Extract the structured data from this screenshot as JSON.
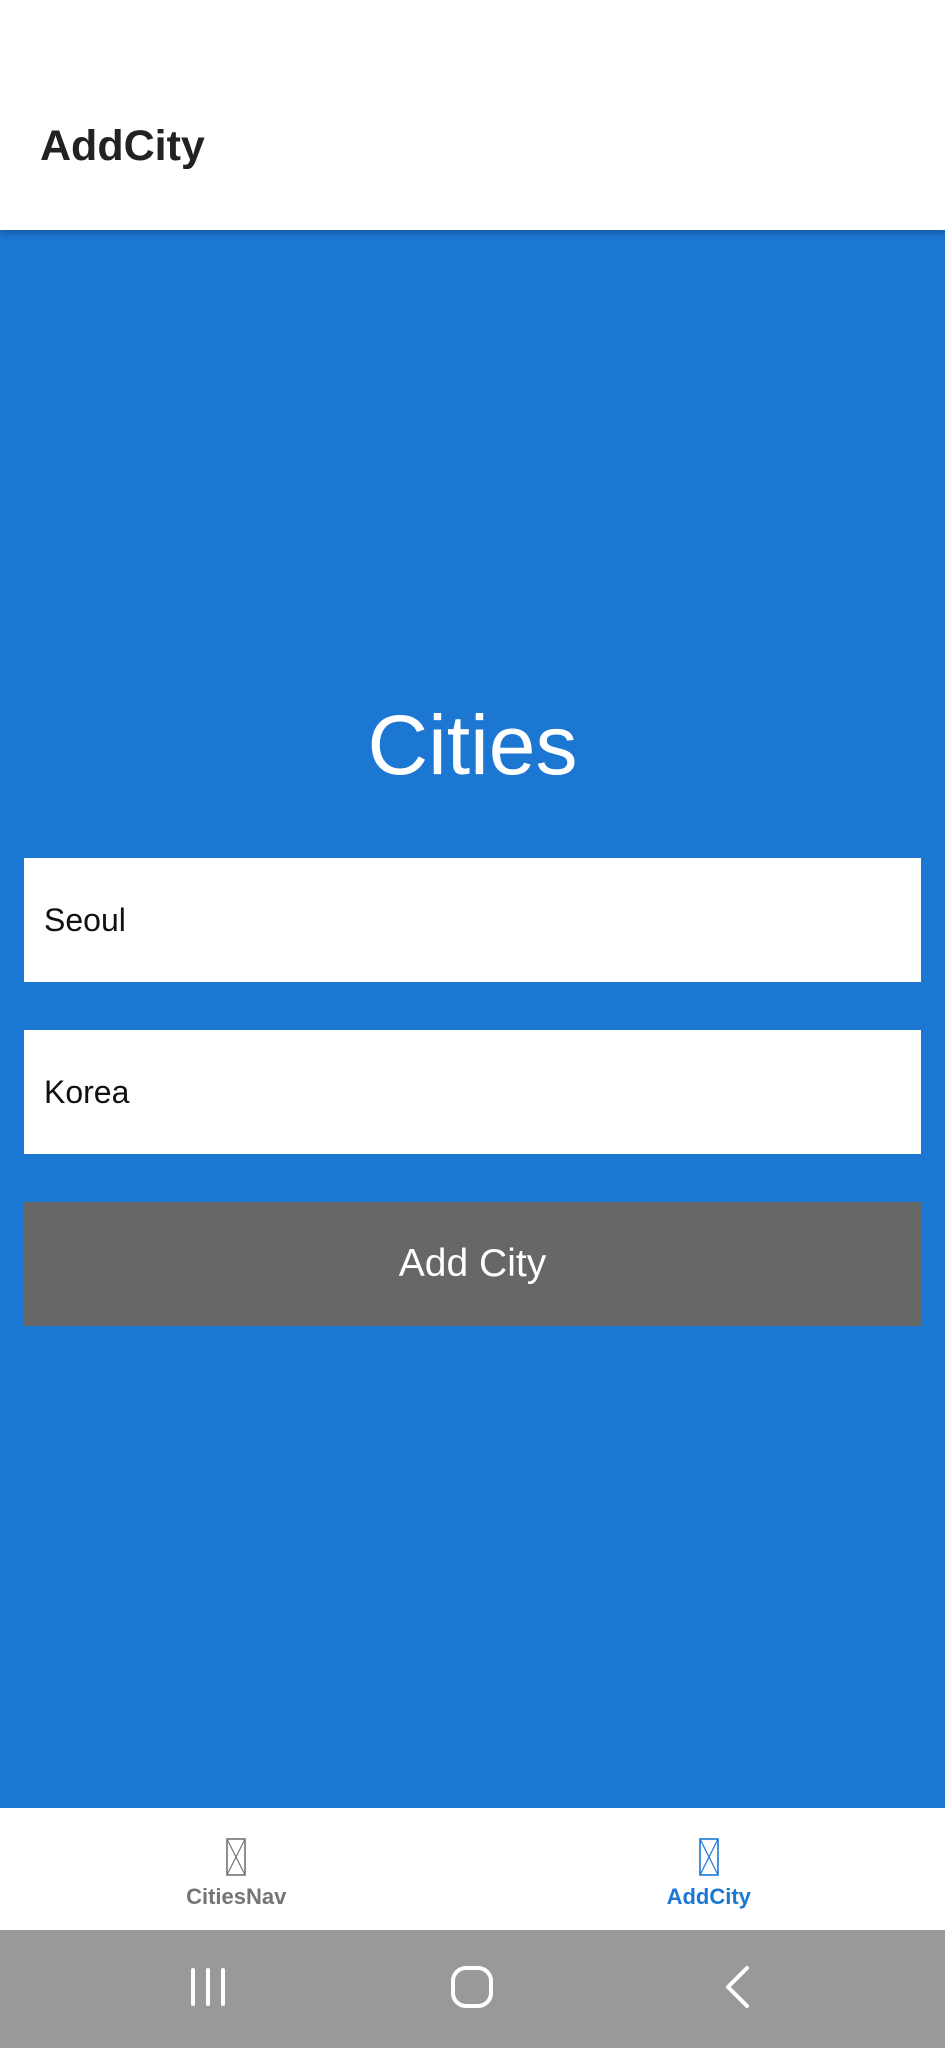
{
  "header": {
    "title": "AddCity"
  },
  "main": {
    "title": "Cities",
    "city_field": {
      "value": "Seoul"
    },
    "country_field": {
      "value": "Korea"
    },
    "add_button_label": "Add City"
  },
  "tabs": [
    {
      "label": "CitiesNav",
      "icon": "missing-glyph-icon",
      "active": false
    },
    {
      "label": "AddCity",
      "icon": "missing-glyph-icon",
      "active": true
    }
  ],
  "system_nav": {
    "buttons": [
      "recent-apps-icon",
      "home-icon",
      "back-icon"
    ]
  },
  "colors": {
    "primary": "#1c77d3",
    "button": "#676767",
    "header_bg": "#ffffff",
    "tab_inactive": "#757575",
    "system_nav_bg": "#999999"
  }
}
